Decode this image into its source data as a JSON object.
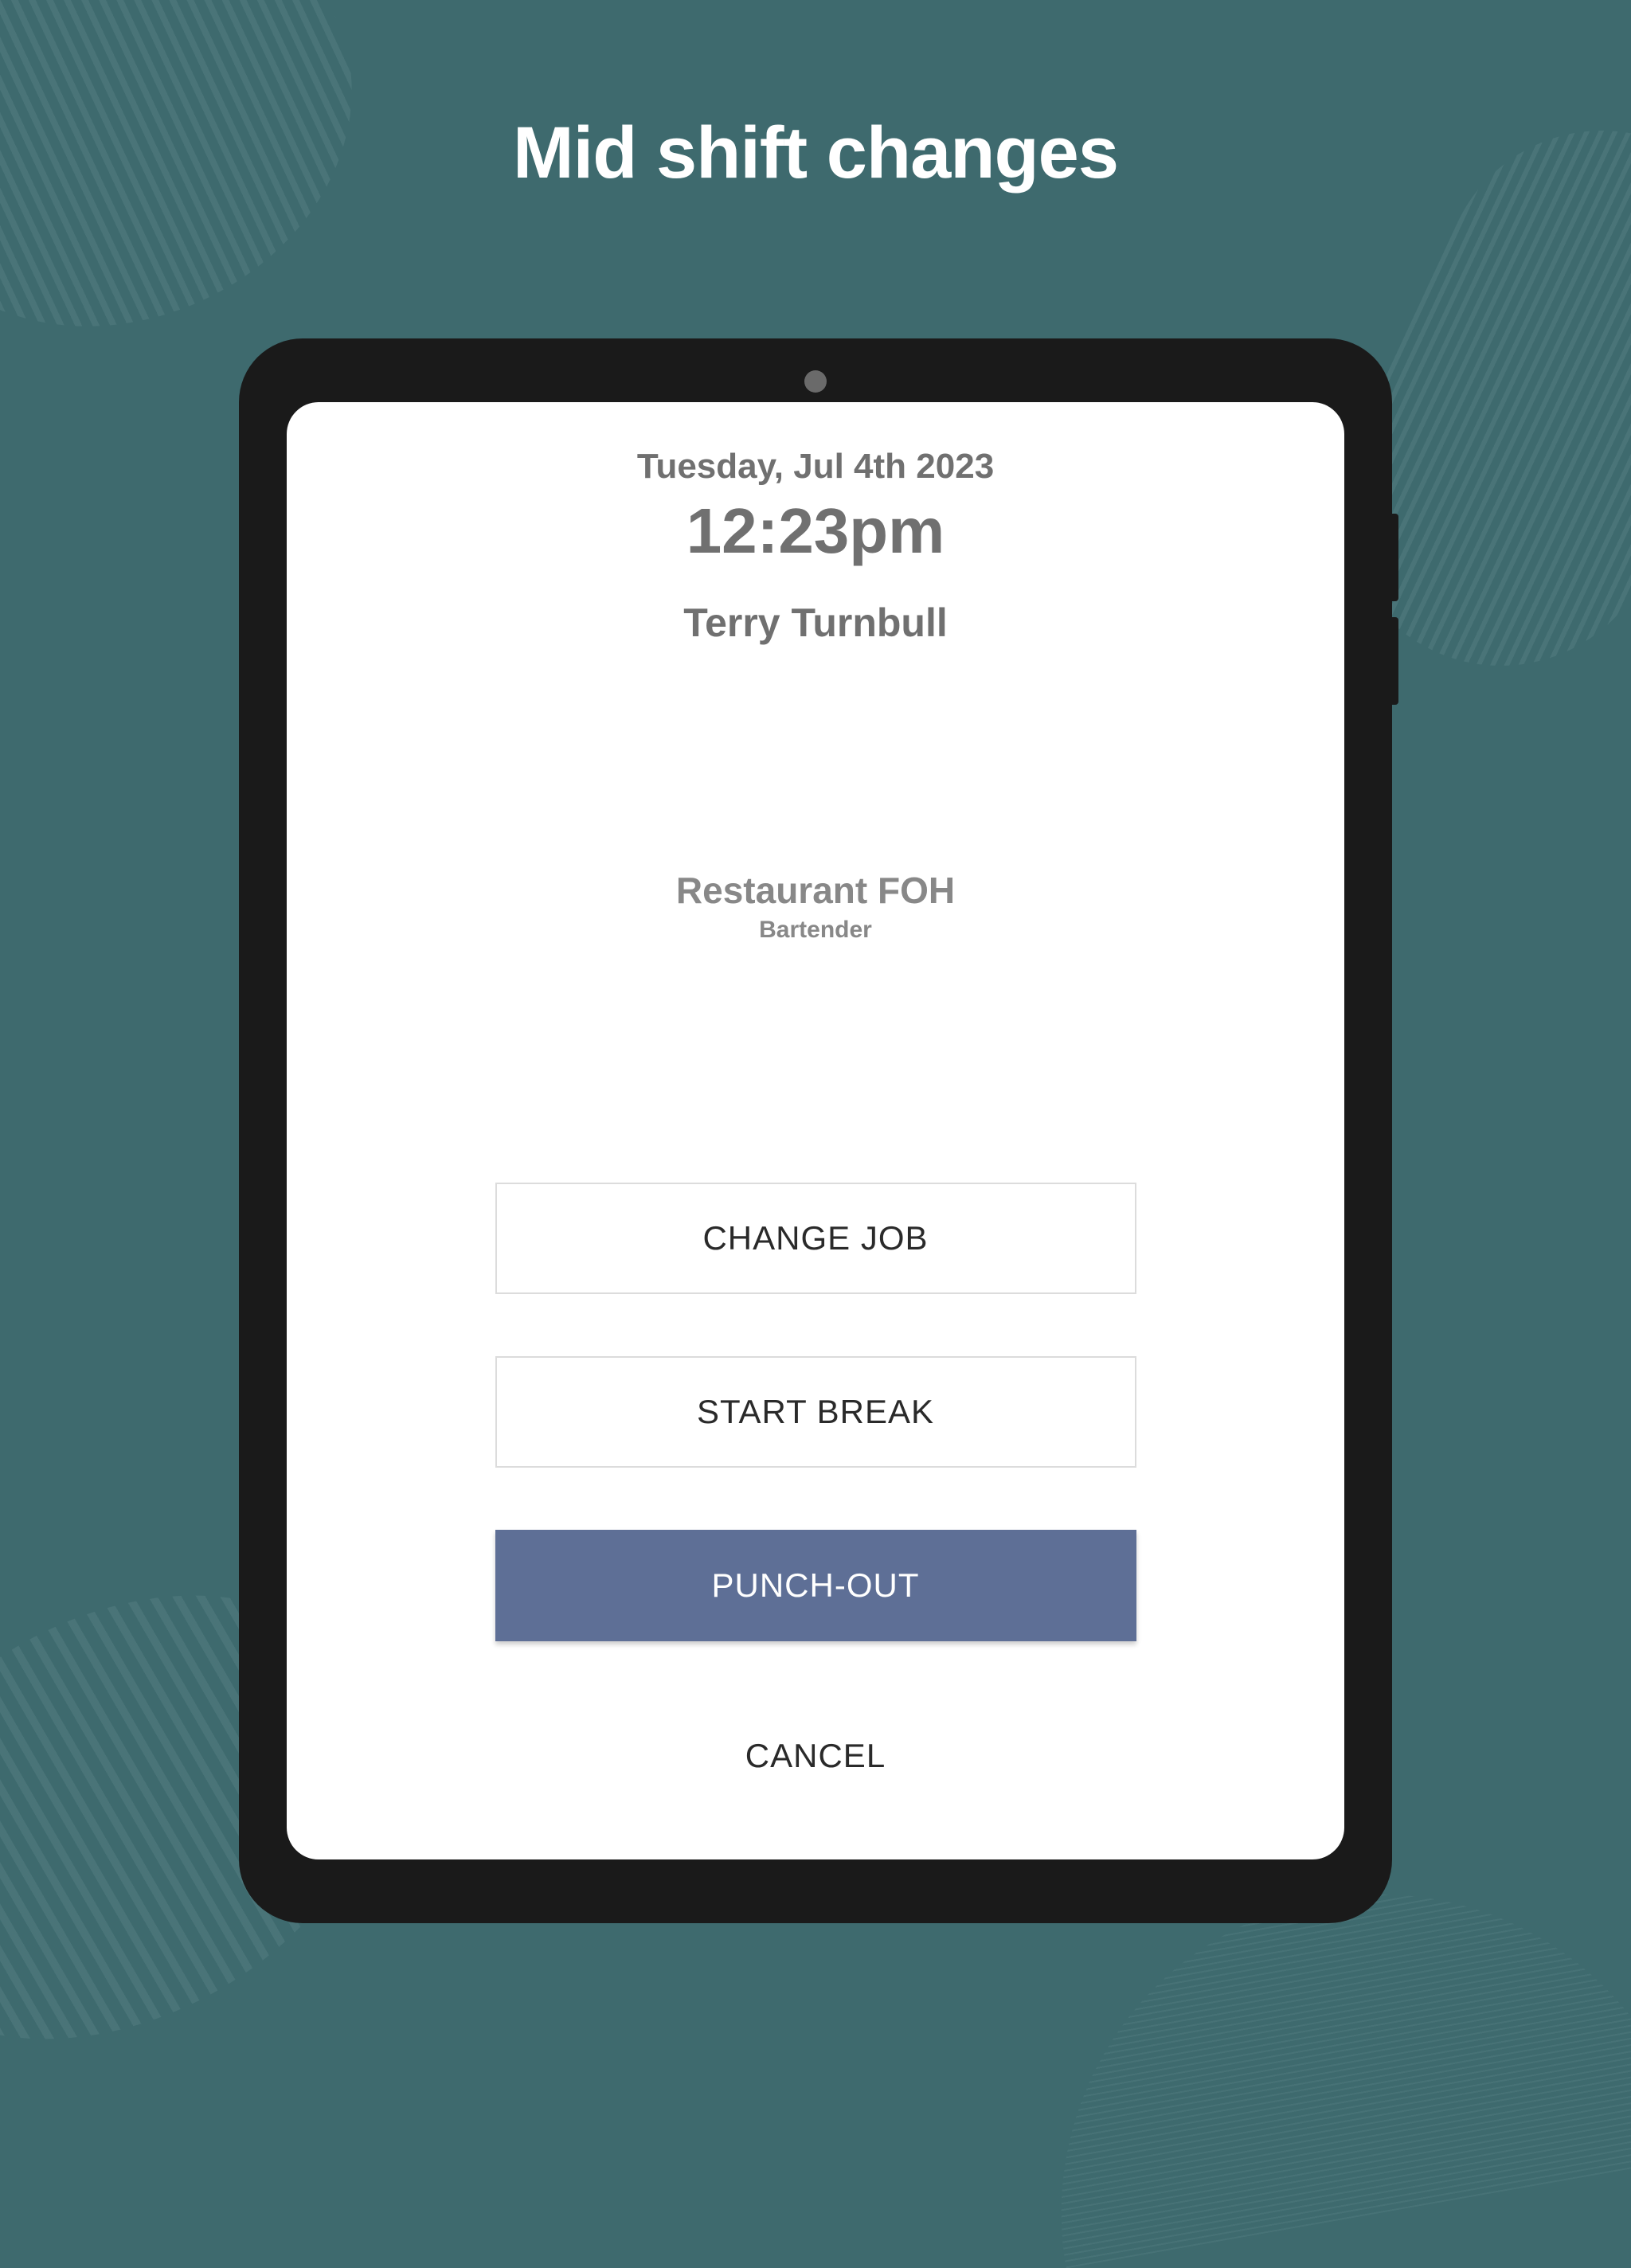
{
  "page": {
    "title": "Mid shift changes"
  },
  "header": {
    "date": "Tuesday, Jul 4th 2023",
    "time": "12:23pm",
    "employee_name": "Terry Turnbull"
  },
  "job": {
    "department": "Restaurant FOH",
    "role": "Bartender"
  },
  "actions": {
    "change_job_label": "CHANGE JOB",
    "start_break_label": "START BREAK",
    "punch_out_label": "PUNCH-OUT",
    "cancel_label": "CANCEL"
  },
  "colors": {
    "background": "#3e6a6e",
    "primary_button": "#5e6f96",
    "text_muted": "#707070"
  }
}
